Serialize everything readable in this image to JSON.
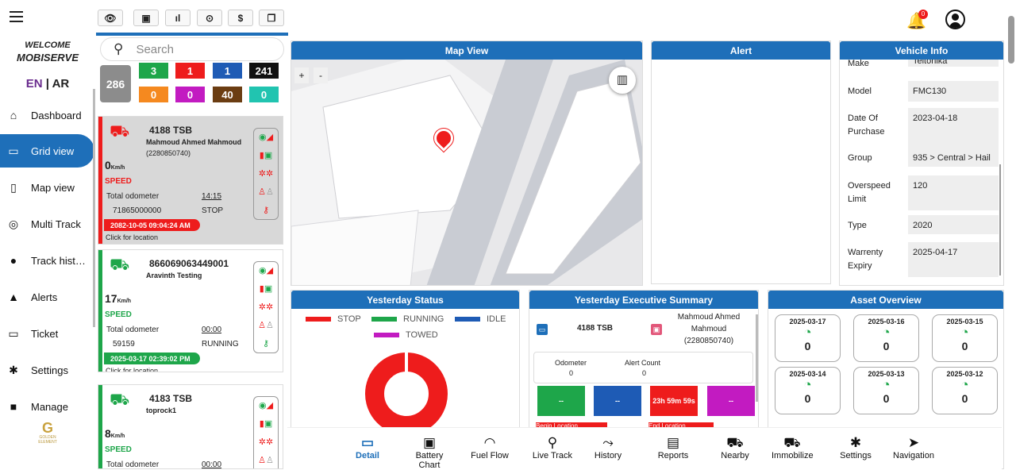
{
  "nav": {
    "welcome": "WELCOME",
    "brand": "MOBISERVE",
    "lang_en": "EN",
    "lang_sep": "|",
    "lang_ar": "AR",
    "items": [
      {
        "label": "Dashboard",
        "icon": "home-icon",
        "glyph": "⌂"
      },
      {
        "label": "Grid view",
        "icon": "grid-icon",
        "glyph": "▭"
      },
      {
        "label": "Map view",
        "icon": "map-icon",
        "glyph": "▯"
      },
      {
        "label": "Multi Track",
        "icon": "pin-outline-icon",
        "glyph": "◎"
      },
      {
        "label": "Track hist…",
        "icon": "pin-icon",
        "glyph": "●"
      },
      {
        "label": "Alerts",
        "icon": "warning-icon",
        "glyph": "▲"
      },
      {
        "label": "Ticket",
        "icon": "ticket-icon",
        "glyph": "▭"
      },
      {
        "label": "Settings",
        "icon": "gear-icon",
        "glyph": "✱"
      },
      {
        "label": "Manage",
        "icon": "folder-icon",
        "glyph": "■"
      }
    ],
    "logo_text": "GOLDEN ELEMENT"
  },
  "toolbar": {
    "buttons": [
      {
        "icon": "eye-icon",
        "glyph": "👁"
      },
      {
        "icon": "battery-icon",
        "glyph": "▣"
      },
      {
        "icon": "signal-icon",
        "glyph": "ıl"
      },
      {
        "icon": "target-icon",
        "glyph": "⊙"
      },
      {
        "icon": "dollar-icon",
        "glyph": "$"
      },
      {
        "icon": "copy-icon",
        "glyph": "❐"
      }
    ]
  },
  "header": {
    "notif_count": "0"
  },
  "list": {
    "search_placeholder": "Search",
    "total": "286",
    "counts": [
      {
        "v": "3",
        "c": "#1ea64a"
      },
      {
        "v": "1",
        "c": "#ee1c1c"
      },
      {
        "v": "1",
        "c": "#1e5bb5"
      },
      {
        "v": "241",
        "c": "#111111"
      },
      {
        "v": "0",
        "c": "#f5891f"
      },
      {
        "v": "0",
        "c": "#c21bc1"
      },
      {
        "v": "40",
        "c": "#6b3d12"
      },
      {
        "v": "0",
        "c": "#21c4b0"
      }
    ],
    "vehicles": [
      {
        "plate": "4188 TSB",
        "driver": "Mahmoud Ahmed Mahmoud",
        "driver_id": "(2280850740)",
        "speed": "0",
        "unit": "Km/h",
        "speed_label": "SPEED",
        "odo_label": "Total odometer",
        "odo": "71865000000",
        "time": "14:15",
        "status": "STOP",
        "timestamp": "2082-10-05 09:04:24 AM",
        "click": "Click for location",
        "color": "#ee1c1c"
      },
      {
        "plate": "866069063449001",
        "driver": "Aravinth Testing",
        "driver_id": "",
        "speed": "17",
        "unit": "Km/h",
        "speed_label": "SPEED",
        "odo_label": "Total odometer",
        "odo": "59159",
        "time": "00:00",
        "status": "RUNNING",
        "timestamp": "2025-03-17 02:39:02 PM",
        "click": "Click for location",
        "color": "#1ea64a"
      },
      {
        "plate": "4183 TSB",
        "driver": "toprock1",
        "driver_id": "",
        "speed": "8",
        "unit": "Km/h",
        "speed_label": "SPEED",
        "odo_label": "Total odometer",
        "odo": "",
        "time": "00:00",
        "status": "",
        "timestamp": "",
        "click": "",
        "color": "#1ea64a"
      }
    ]
  },
  "panels": {
    "map": "Map View",
    "alert": "Alert",
    "vinfo": "Vehicle Info",
    "yst": "Yesterday Status",
    "yes": "Yesterday Executive Summary",
    "aov": "Asset Overview"
  },
  "map": {
    "zoom_in": "+",
    "zoom_out": "-"
  },
  "vinfo": [
    {
      "k": "Make",
      "v": "Teltonika"
    },
    {
      "k": "Model",
      "v": "FMC130"
    },
    {
      "k": "Date Of Purchase",
      "v": "2023-04-18"
    },
    {
      "k": "Group",
      "v": "935 > Central > Hail"
    },
    {
      "k": "Overspeed Limit",
      "v": "120"
    },
    {
      "k": "Type",
      "v": "2020"
    },
    {
      "k": "Warrenty Expiry",
      "v": "2025-04-17"
    }
  ],
  "yst": {
    "legend": [
      {
        "label": "STOP",
        "color": "#ee1c1c"
      },
      {
        "label": "RUNNING",
        "color": "#1ea64a"
      },
      {
        "label": "IDLE",
        "color": "#1e5bb5"
      },
      {
        "label": "TOWED",
        "color": "#c21bc1"
      }
    ],
    "stop_fraction": 1.0
  },
  "yes": {
    "plate": "4188 TSB",
    "driver": "Mahmoud Ahmed Mahmoud (2280850740)",
    "odo_label": "Odometer",
    "odo": "0",
    "alert_label": "Alert Count",
    "alert": "0",
    "tiles": [
      {
        "v": "--",
        "c": "#1ea64a"
      },
      {
        "v": "--",
        "c": "#1e5bb5"
      },
      {
        "v": "23h 59m 59s",
        "c": "#ee1c1c"
      },
      {
        "v": "--",
        "c": "#c21bc1"
      }
    ],
    "begin": "Begin Location",
    "end": "End Location"
  },
  "aov": [
    {
      "d": "2025-03-17",
      "v": "0"
    },
    {
      "d": "2025-03-16",
      "v": "0"
    },
    {
      "d": "2025-03-15",
      "v": "0"
    },
    {
      "d": "2025-03-14",
      "v": "0"
    },
    {
      "d": "2025-03-13",
      "v": "0"
    },
    {
      "d": "2025-03-12",
      "v": "0"
    }
  ],
  "bottom": [
    {
      "label": "Detail",
      "icon": "detail-icon",
      "glyph": "▭"
    },
    {
      "label": "Battery Chart",
      "icon": "battery-icon",
      "glyph": "▣"
    },
    {
      "label": "Fuel Flow",
      "icon": "gauge-icon",
      "glyph": "◠"
    },
    {
      "label": "Live Track",
      "icon": "live-track-icon",
      "glyph": "⚲"
    },
    {
      "label": "History",
      "icon": "route-icon",
      "glyph": "⤳"
    },
    {
      "label": "Reports",
      "icon": "report-icon",
      "glyph": "▤"
    },
    {
      "label": "Nearby",
      "icon": "car-icon",
      "glyph": "⛟"
    },
    {
      "label": "Immobilize",
      "icon": "immobilize-icon",
      "glyph": "⛟"
    },
    {
      "label": "Settings",
      "icon": "gear-icon",
      "glyph": "✱"
    },
    {
      "label": "Navigation",
      "icon": "navigation-icon",
      "glyph": "➤"
    }
  ]
}
